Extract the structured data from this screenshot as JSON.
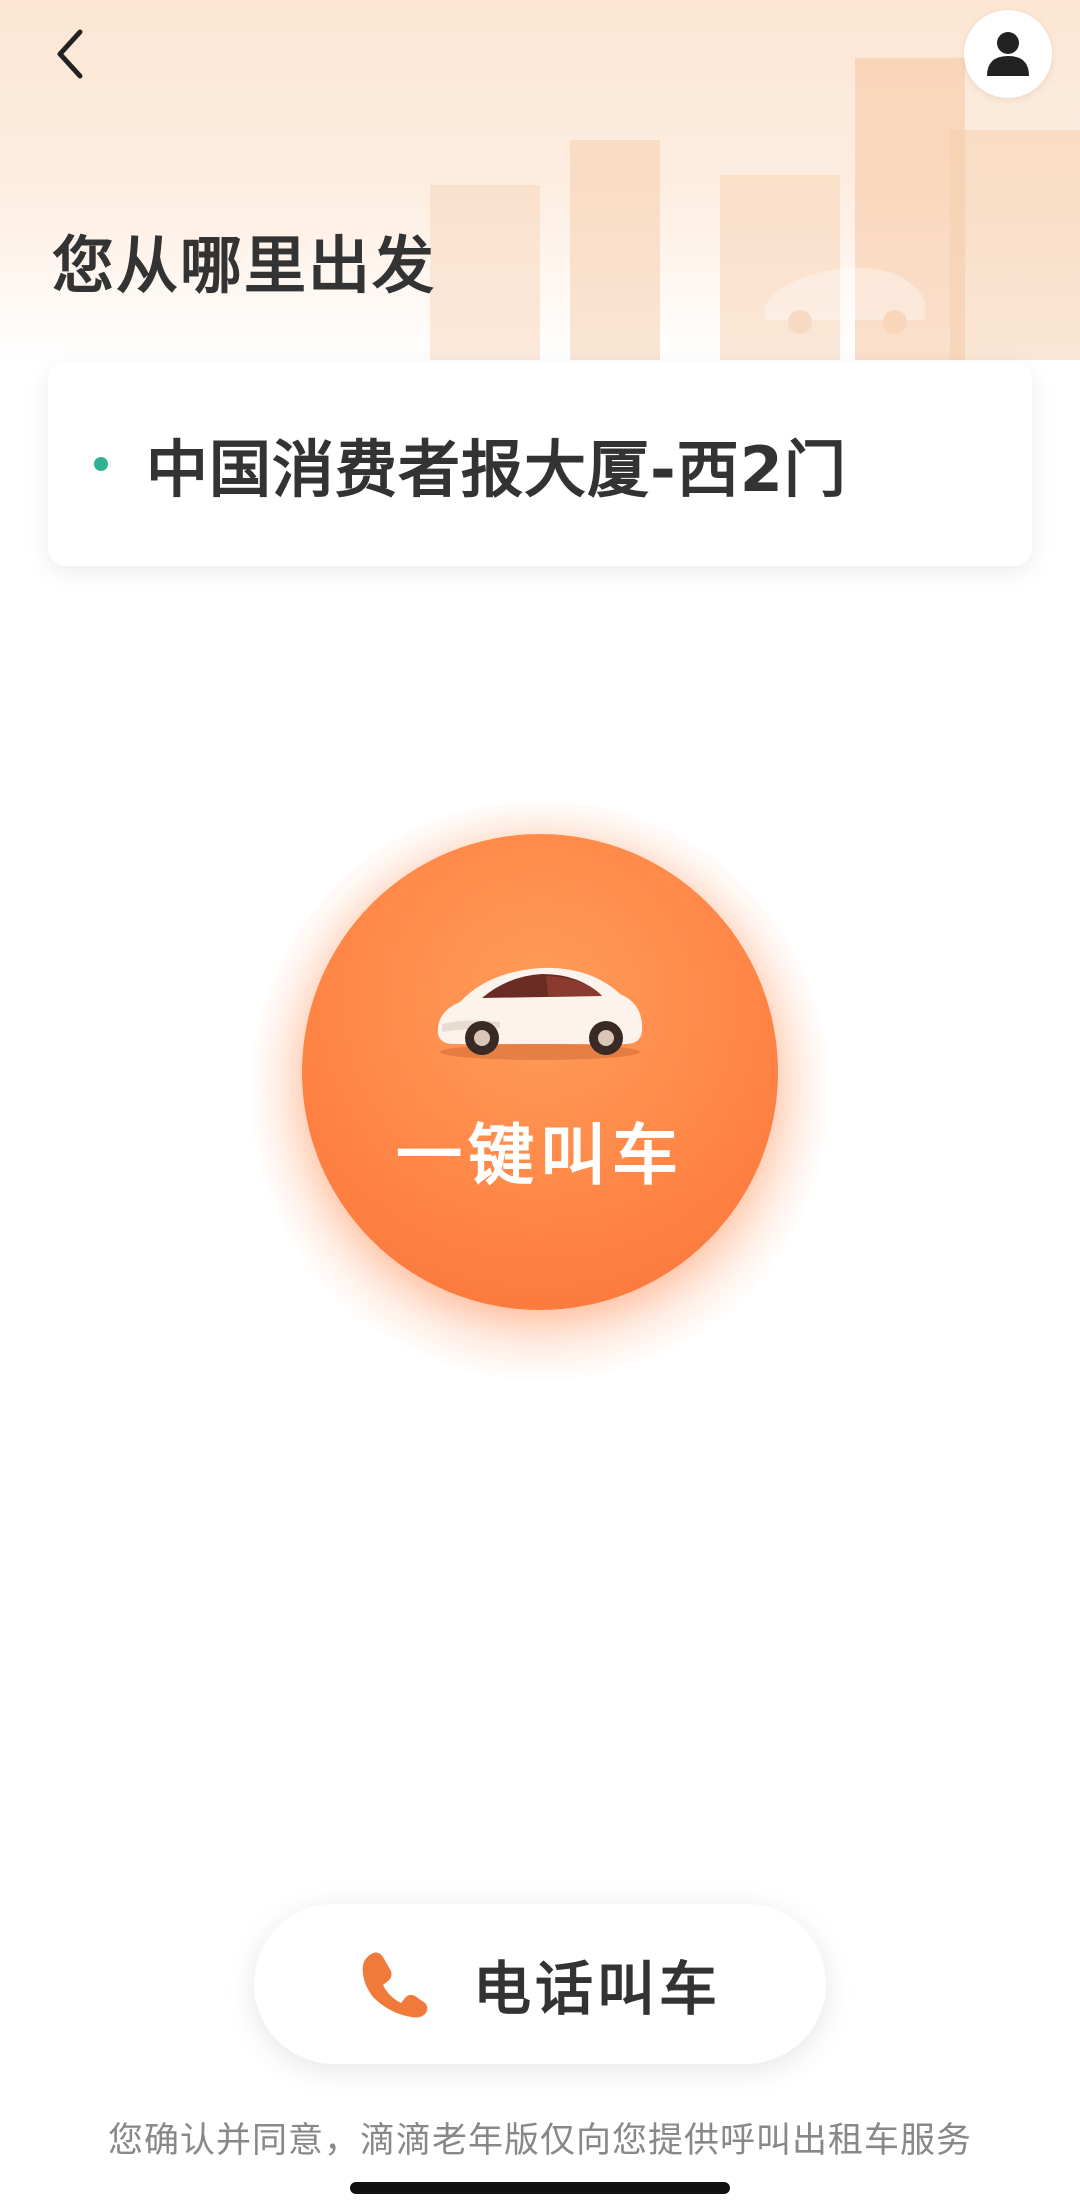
{
  "header": {
    "title": "您从哪里出发",
    "back_icon": "chevron-left-icon",
    "profile_icon": "user-icon"
  },
  "origin": {
    "text": "中国消费者报大厦-西2门",
    "dot_color": "#2fb192"
  },
  "call_button": {
    "label": "一键叫车",
    "icon": "car-icon",
    "color": "#ff8a4a"
  },
  "phone_call": {
    "label": "电话叫车",
    "icon": "phone-icon",
    "icon_color": "#f07a3a"
  },
  "footer": {
    "disclaimer": "您确认并同意，滴滴老年版仅向您提供呼叫出租车服务"
  }
}
